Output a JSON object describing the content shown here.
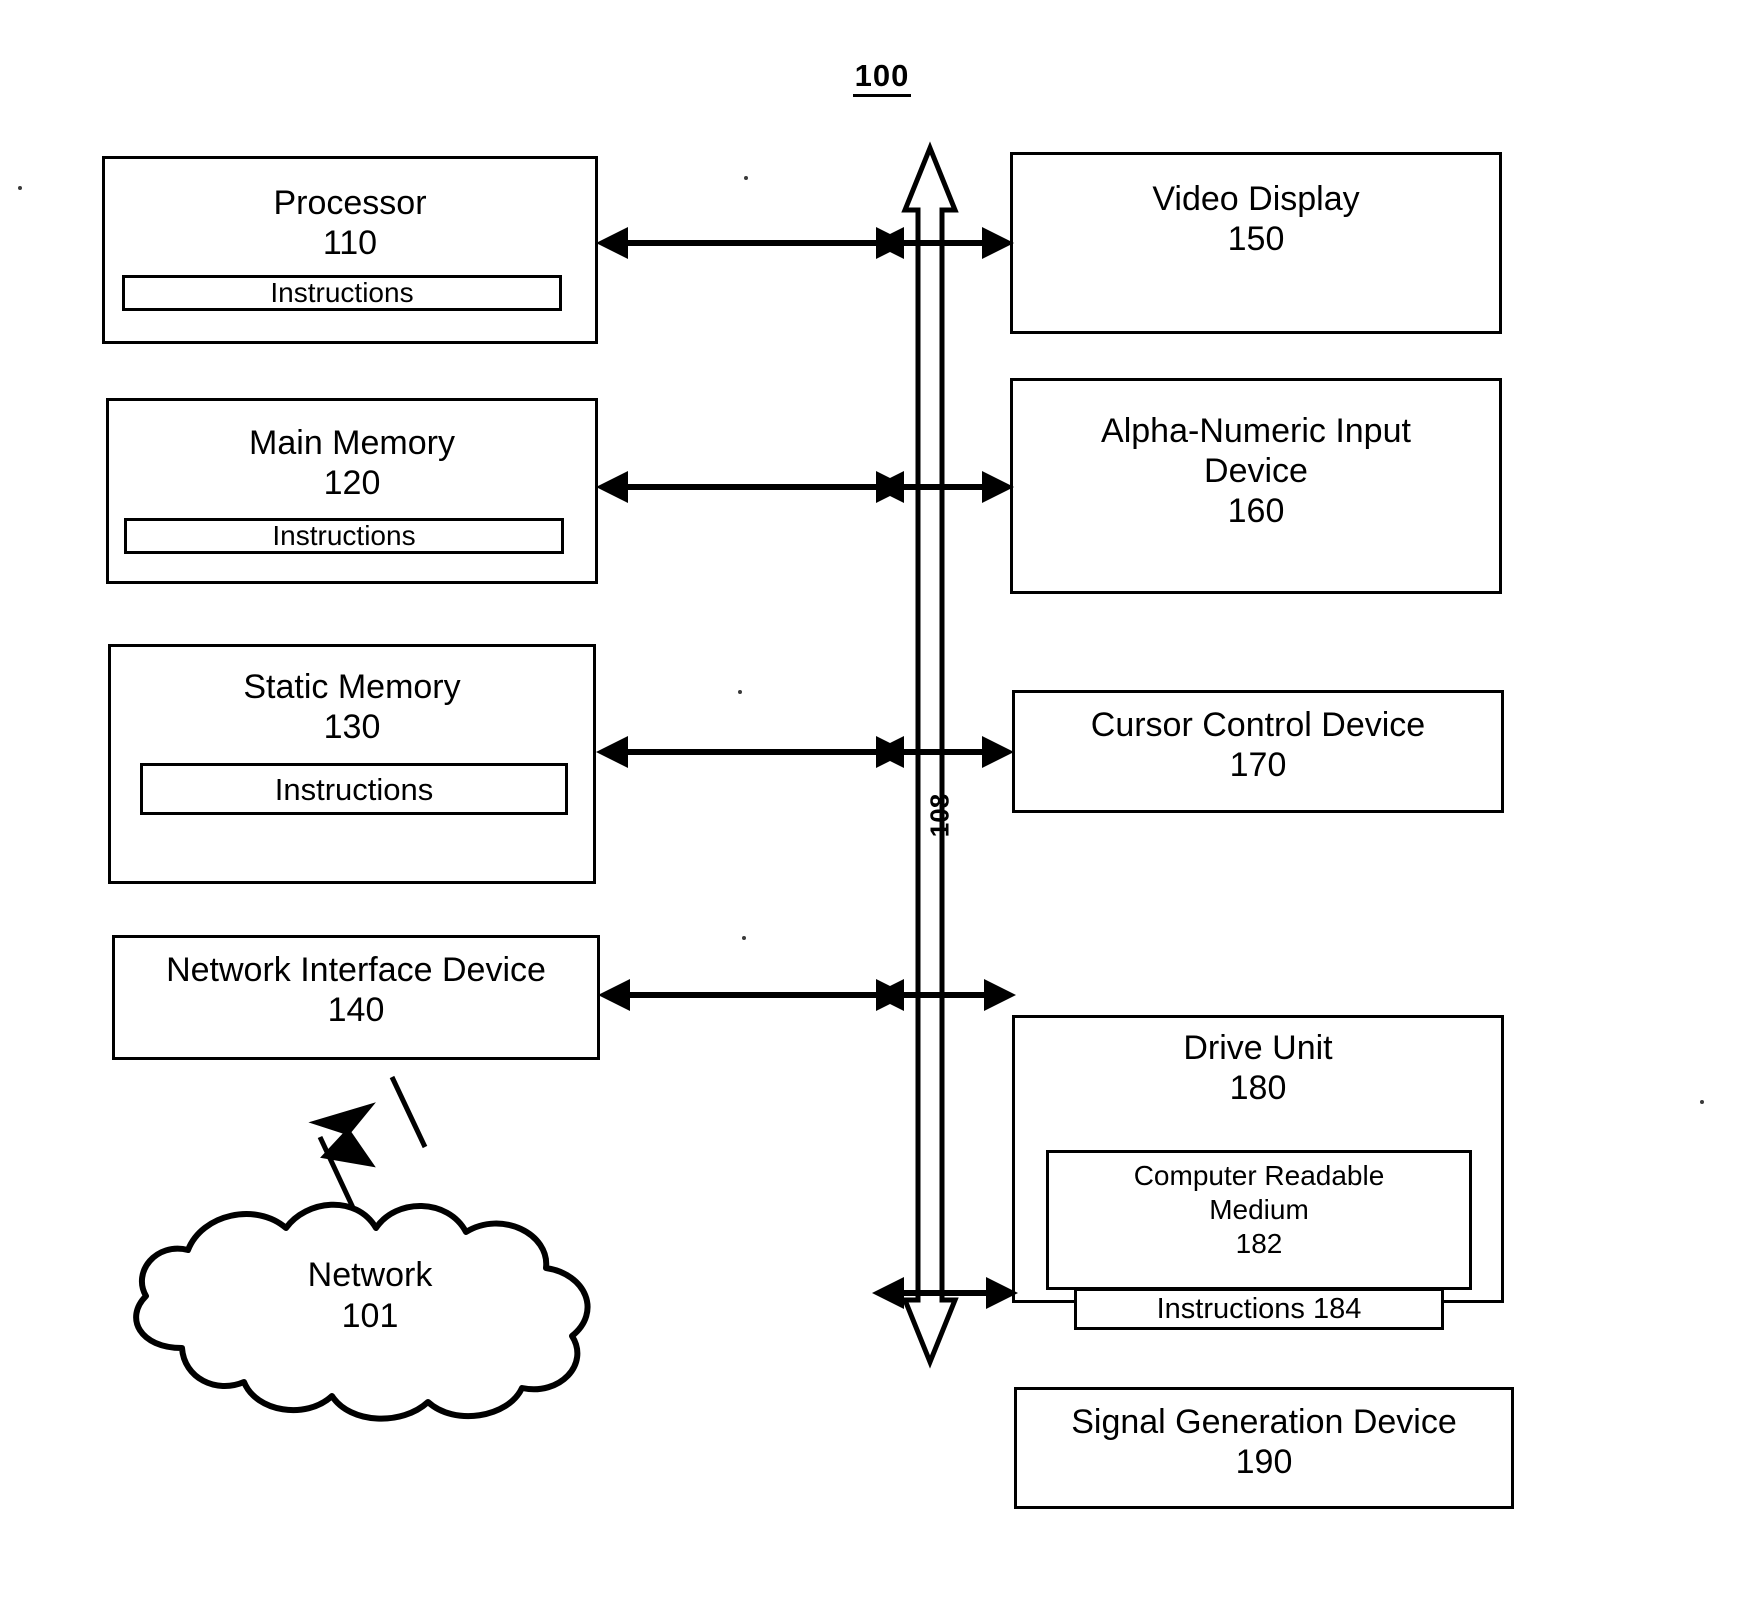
{
  "figure": {
    "number": "100",
    "bus_reference": "108"
  },
  "left_column": [
    {
      "name": "processor",
      "title": "Processor",
      "ref": "110",
      "inner": {
        "name": "instructions",
        "label": "Instructions"
      }
    },
    {
      "name": "main-memory",
      "title": "Main Memory",
      "ref": "120",
      "inner": {
        "name": "instructions",
        "label": "Instructions"
      }
    },
    {
      "name": "static-memory",
      "title": "Static Memory",
      "ref": "130",
      "inner": {
        "name": "instructions",
        "label": "Instructions"
      }
    },
    {
      "name": "network-interface-device",
      "title": "Network Interface Device",
      "ref": "140",
      "inner": null
    }
  ],
  "right_column": [
    {
      "name": "video-display",
      "title": "Video Display",
      "ref": "150"
    },
    {
      "name": "alpha-numeric-input-device",
      "title": "Alpha-Numeric Input\nDevice",
      "ref": "160"
    },
    {
      "name": "cursor-control-device",
      "title": "Cursor Control Device",
      "ref": "170"
    },
    {
      "name": "drive-unit",
      "title": "Drive Unit",
      "ref": "180",
      "nested": {
        "name": "computer-readable-medium",
        "title": "Computer Readable\nMedium",
        "ref": "182",
        "inner": {
          "name": "instructions-184",
          "label": "Instructions 184"
        }
      }
    },
    {
      "name": "signal-generation-device",
      "title": "Signal Generation Device",
      "ref": "190"
    }
  ],
  "network": {
    "title": "Network",
    "ref": "101"
  },
  "colors": {
    "ink": "#000000",
    "paper": "#ffffff"
  }
}
